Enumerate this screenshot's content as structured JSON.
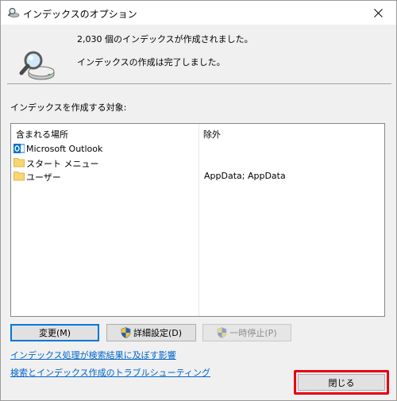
{
  "window": {
    "title": "インデックスのオプション"
  },
  "status": {
    "line1": "2,030 個のインデックスが作成されました。",
    "line2": "インデックスの作成は完了しました。"
  },
  "locations_label": "インデックスを作成する対象:",
  "table": {
    "columns": [
      "含まれる場所",
      "除外"
    ],
    "rows": [
      {
        "location": "Microsoft Outlook",
        "exclude": "",
        "icon": "outlook-icon"
      },
      {
        "location": "スタート メニュー",
        "exclude": "",
        "icon": "folder-icon"
      },
      {
        "location": "ユーザー",
        "exclude": "AppData; AppData",
        "icon": "folder-icon"
      }
    ]
  },
  "buttons": {
    "modify": "変更(M)",
    "advanced": "詳細設定(D)",
    "pause": "一時停止(P)",
    "close": "閉じる"
  },
  "links": {
    "effect": "インデックス処理が検索結果に及ぼす影響",
    "troubleshoot": "検索とインデックス作成のトラブルシューティング"
  },
  "colors": {
    "highlight": "#e60012",
    "link": "#0066cc",
    "accent": "#0078d7"
  }
}
